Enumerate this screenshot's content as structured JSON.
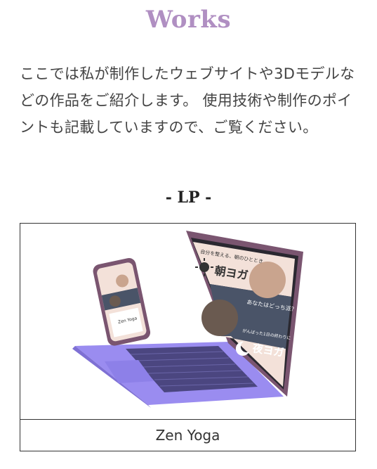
{
  "works": {
    "title": "Works",
    "intro": "ここでは私が制作したウェブサイトや3Dモデルなどの作品をご紹介します。 使用技術や制作のポイントも記載していますので、ご覧ください。"
  },
  "lp_section": {
    "title": "- LP -",
    "card": {
      "caption": "Zen Yoga",
      "mockup": {
        "laptop": {
          "tagline_top": "自分を整える、朝のひととき",
          "heading_top": "朝ヨガ",
          "question": "あなたはどっち派？",
          "tagline_bottom": "がんばった1日の終わりに",
          "heading_bottom": "夜ヨガ"
        },
        "phone": {
          "brand": "Zen Yoga"
        }
      }
    }
  },
  "colors": {
    "accent": "#b08fc2",
    "laptop_base": "#9a8cf0",
    "laptop_lid": "#7a5570",
    "screen_navy": "#4a5468",
    "screen_peach": "#f3e1d9"
  }
}
